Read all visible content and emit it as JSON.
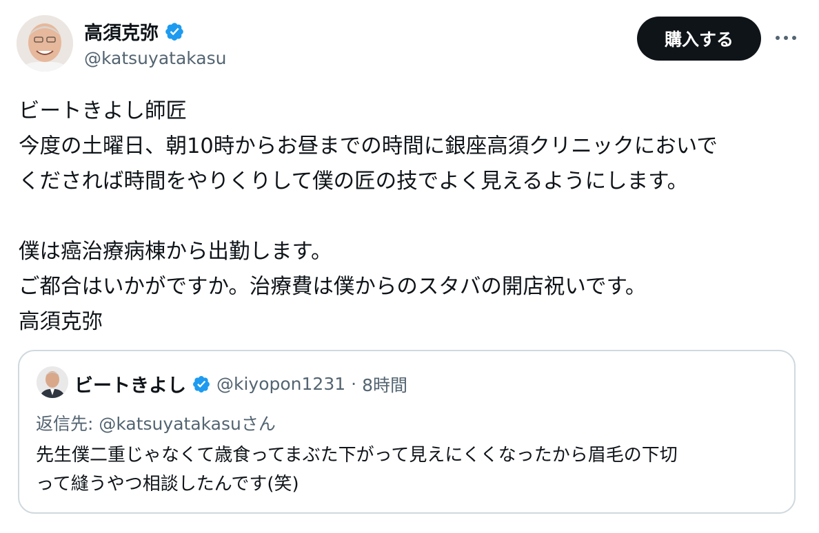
{
  "author": {
    "display_name": "高須克弥",
    "handle": "@katsuyatakasu"
  },
  "actions": {
    "buy_label": "購入する"
  },
  "tweet": {
    "lines": [
      "ビートきよし師匠",
      "今度の土曜日、朝10時からお昼までの時間に銀座高須クリニックにおいで",
      "くだされば時間をやりくりして僕の匠の技でよく見えるようにします。",
      "",
      "僕は癌治療病棟から出勤します。",
      "ご都合はいかがですか。治療費は僕からのスタバの開店祝いです。",
      "高須克弥"
    ]
  },
  "quoted": {
    "display_name": "ビートきよし",
    "handle": "@kiyopon1231",
    "separator": "·",
    "time": "8時間",
    "reply_to": "返信先: @katsuyatakasuさん",
    "lines": [
      "先生僕二重じゃなくて歳食ってまぶた下がって見えにくくなったから眉毛の下切",
      "って縫うやつ相談したんです(笑)"
    ]
  },
  "colors": {
    "verified": "#1d9bf0",
    "text": "#0f1419",
    "secondary": "#536471",
    "border": "#cfd9de",
    "button_bg": "#0f1419"
  }
}
